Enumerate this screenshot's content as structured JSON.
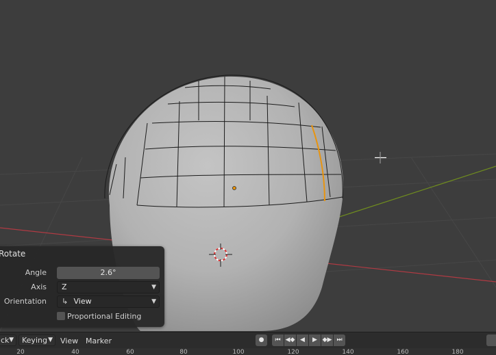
{
  "viewport": {
    "name": "3D Viewport"
  },
  "redo_panel": {
    "title": "Rotate",
    "angle_label": "Angle",
    "angle_value": "2.6°",
    "axis_label": "Axis",
    "axis_value": "Z",
    "orientation_label": "Orientation",
    "orientation_value": "View",
    "proportional_label": "Proportional Editing",
    "proportional_checked": false
  },
  "timeline": {
    "playback_label": "ck",
    "keying_label": "Keying",
    "view_label": "View",
    "marker_label": "Marker",
    "ruler_ticks": [
      "20",
      "40",
      "60",
      "80",
      "100",
      "120",
      "140",
      "160",
      "180"
    ]
  },
  "colors": {
    "background": "#3d3d3d",
    "selected_edge": "#e8940f",
    "x_axis": "#b13a43",
    "y_axis": "#6f8c1f"
  },
  "icons": {
    "transform_cursor": "crosshair-move-icon",
    "3d_cursor": "3d-cursor-icon",
    "record": "record-icon",
    "jump_start": "jump-start-icon",
    "prev_keyframe": "prev-keyframe-icon",
    "play_reverse": "play-reverse-icon",
    "play": "play-icon",
    "next_keyframe": "next-keyframe-icon",
    "jump_end": "jump-end-icon"
  }
}
